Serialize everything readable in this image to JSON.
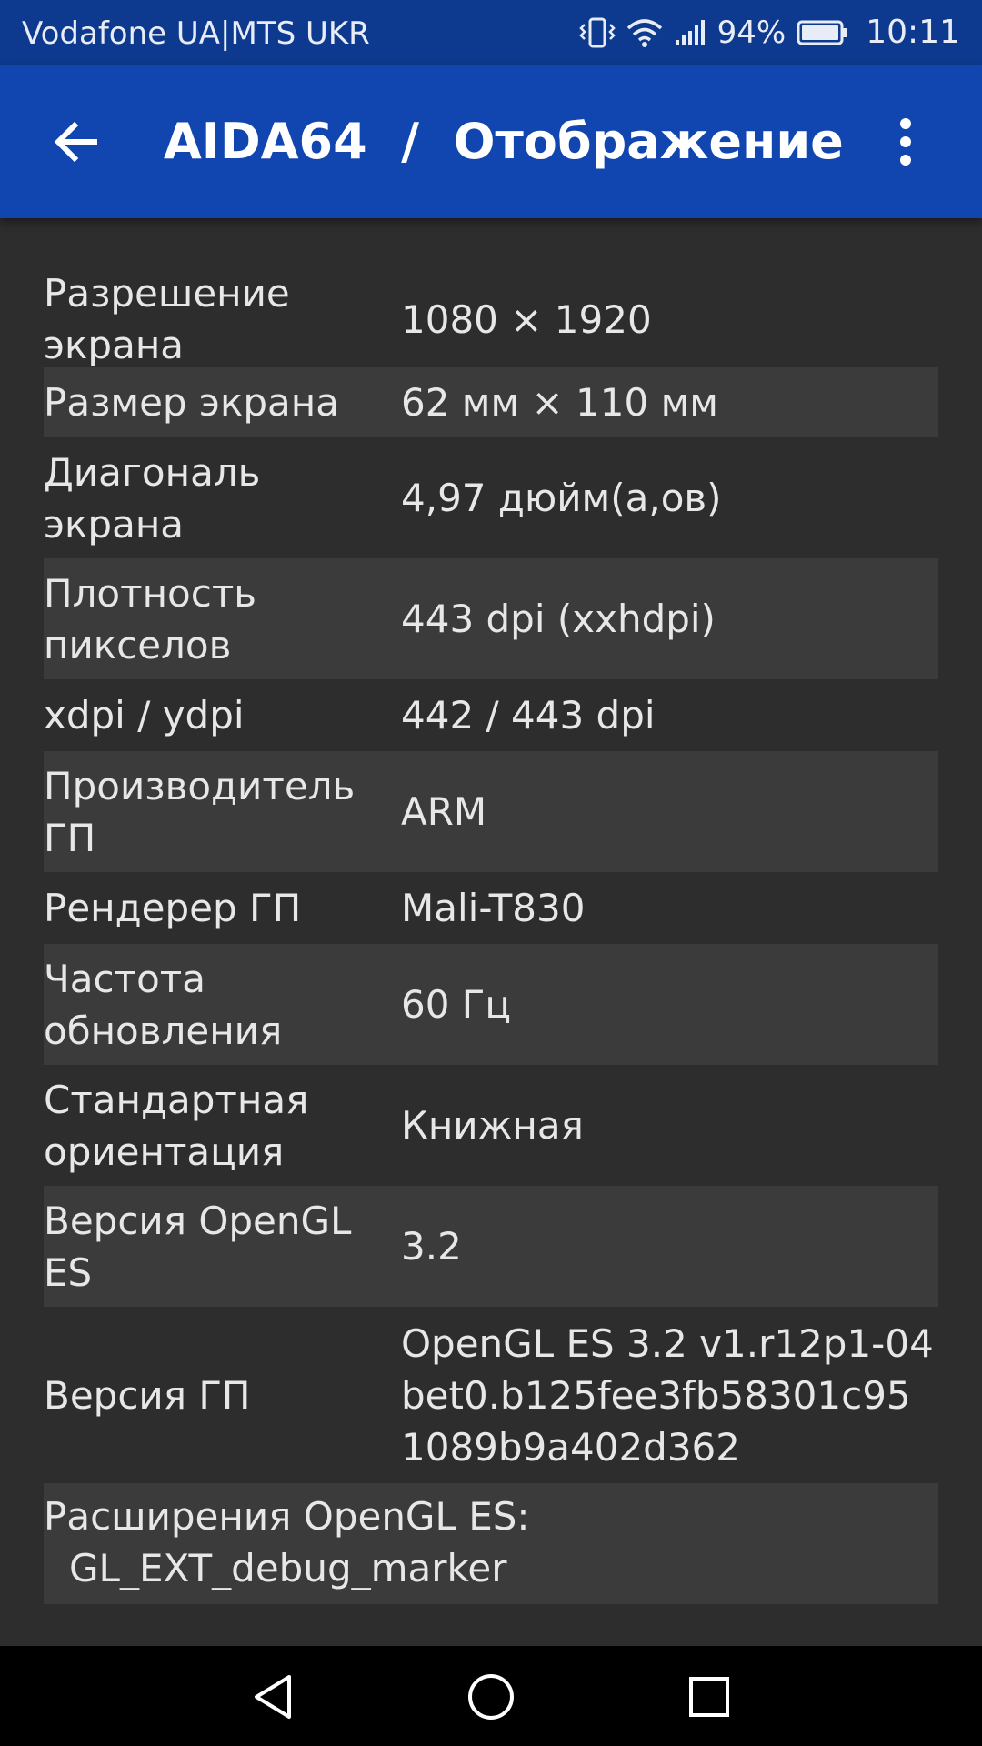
{
  "status_bar": {
    "carrier": "Vodafone UA|MTS UKR",
    "battery_percent": "94%",
    "time": "10:11",
    "icons": [
      "vibrate-icon",
      "wifi-icon",
      "signal-icon",
      "battery-icon"
    ]
  },
  "app_bar": {
    "title": "AIDA64  /  Отображение",
    "back_icon": "arrow-back-icon",
    "menu_icon": "more-vert-icon"
  },
  "display_info": {
    "rows": [
      {
        "key": "Разрешение\nэкрана",
        "value": "1080 × 1920"
      },
      {
        "key": "Размер экрана",
        "value": "62 мм × 110 мм"
      },
      {
        "key": "Диагональ\nэкрана",
        "value": "4,97 дюйм(а,ов)"
      },
      {
        "key": "Плотность\nпикселов",
        "value": "443 dpi (xxhdpi)"
      },
      {
        "key": "xdpi / ydpi",
        "value": "442 / 443 dpi"
      },
      {
        "key": "Производитель\nГП",
        "value": "ARM"
      },
      {
        "key": "Рендерер ГП",
        "value": "Mali-T830"
      },
      {
        "key": "Частота\nобновления",
        "value": "60 Гц"
      },
      {
        "key": "Стандартная\nориентация",
        "value": "Книжная"
      },
      {
        "key": "Версия OpenGL\nES",
        "value": "3.2"
      },
      {
        "key": "Версия ГП",
        "value": "OpenGL ES 3.2 v1.r12p1-04\nbet0.b125fee3fb58301c95\n1089b9a402d362"
      }
    ],
    "extensions": {
      "label": "Расширения OpenGL ES:",
      "first_item": "GL_EXT_debug_marker"
    }
  },
  "nav_bar": {
    "icons": [
      "nav-back-icon",
      "nav-home-icon",
      "nav-recents-icon"
    ]
  },
  "colors": {
    "status_bar": "#0d3a8e",
    "app_bar": "#1146b1",
    "background": "#2d2d2d",
    "row_alt": "#3b3b3b",
    "text": "#e7e7e7"
  }
}
